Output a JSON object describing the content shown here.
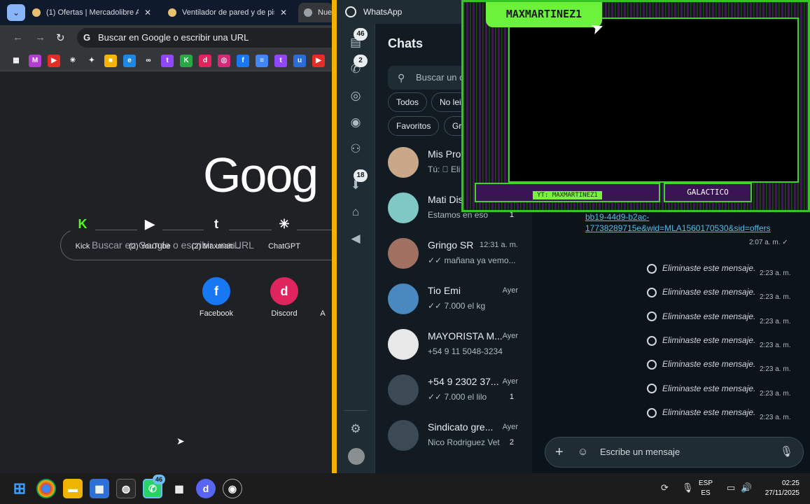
{
  "chrome": {
    "tabs": [
      {
        "title": "(1) Ofertas | Mercadolibre Ar"
      },
      {
        "title": "Ventilador de pared y de pis"
      },
      {
        "title": "Nue"
      }
    ],
    "omnibox_text": "Buscar en Google o escribir una URL",
    "bookmarks": [
      {
        "icon": "apps-icon",
        "glyph": "▦",
        "color": "#35363a"
      },
      {
        "icon": "mercado-icon",
        "glyph": "M",
        "color": "#b23dd3"
      },
      {
        "icon": "youtube-icon",
        "glyph": "▶",
        "color": "#e52d27"
      },
      {
        "icon": "chatgpt-icon",
        "glyph": "✳",
        "color": "#35363a"
      },
      {
        "icon": "gemini-icon",
        "glyph": "✦",
        "color": "#35363a"
      },
      {
        "icon": "keep-icon",
        "glyph": "■",
        "color": "#f4b400"
      },
      {
        "icon": "edge-icon",
        "glyph": "e",
        "color": "#1e88e5"
      },
      {
        "icon": "meta-icon",
        "glyph": "∞",
        "color": "#35363a"
      },
      {
        "icon": "twitch-icon",
        "glyph": "t",
        "color": "#9146ff"
      },
      {
        "icon": "kick-icon",
        "glyph": "K",
        "color": "#28a745"
      },
      {
        "icon": "discord-icon",
        "glyph": "d",
        "color": "#e0245e"
      },
      {
        "icon": "instagram-icon",
        "glyph": "◎",
        "color": "#d62976"
      },
      {
        "icon": "facebook-icon",
        "glyph": "f",
        "color": "#1877f2"
      },
      {
        "icon": "docs-icon",
        "glyph": "≡",
        "color": "#4285f4"
      },
      {
        "icon": "twitch2-icon",
        "glyph": "t",
        "color": "#9146ff"
      },
      {
        "icon": "u-icon",
        "glyph": "u",
        "color": "#2a6dd9"
      },
      {
        "icon": "youtube2-icon",
        "glyph": "▶",
        "color": "#e52d27"
      }
    ],
    "logo_text": "Goog",
    "ntp_search_placeholder": "Buscar en Google o escribir una URL",
    "shortcuts": [
      {
        "label": "Kick",
        "glyph": "K",
        "fg": "#53fc18",
        "bg": "#202124"
      },
      {
        "label": "(2) YouTube",
        "glyph": "▶",
        "fg": "#fff",
        "bg": "#202124"
      },
      {
        "label": "(2) Maxmarti...",
        "glyph": "t",
        "fg": "#fff",
        "bg": "#202124"
      },
      {
        "label": "ChatGPT",
        "glyph": "✳",
        "fg": "#fff",
        "bg": "#202124"
      },
      {
        "label": "Facebook",
        "glyph": "f",
        "fg": "#fff",
        "bg": "#1877f2"
      },
      {
        "label": "Discord",
        "glyph": "d",
        "fg": "#fff",
        "bg": "#e0245e"
      },
      {
        "label": "A",
        "glyph": "",
        "fg": "#fff",
        "bg": "#202124"
      }
    ]
  },
  "whatsapp": {
    "app_title": "WhatsApp",
    "rail": {
      "chats_badge": "46",
      "calls_badge": "2",
      "downloads_badge": "18"
    },
    "panel_title": "Chats",
    "search_placeholder": "Buscar un c",
    "filters": [
      "Todos",
      "No lei",
      "Favoritos",
      "Gr"
    ],
    "chats": [
      {
        "name": "Mis Proy",
        "time": "",
        "preview": "Tú: ⃠ Eli",
        "count": "",
        "avatar_color": "#c9a88a"
      },
      {
        "name": "Mati Dis",
        "time": "",
        "preview": "Estamos en eso",
        "count": "1",
        "avatar_color": "#7fc8c4"
      },
      {
        "name": "Gringo SR",
        "time": "12:31 a. m.",
        "preview": "✓✓ mañana ya vemo...",
        "count": "",
        "avatar_color": "#a07060"
      },
      {
        "name": "Tio Emi",
        "time": "Ayer",
        "preview": "✓✓ 7.000 el kg",
        "count": "",
        "avatar_color": "#4a88c0"
      },
      {
        "name": "MAYORISTA M...",
        "time": "Ayer",
        "preview": "+54 9 11 5048-3234",
        "count": "",
        "avatar_color": "#e8e8e8"
      },
      {
        "name": "+54 9 2302 37...",
        "time": "Ayer",
        "preview": "✓✓ 7.000 el lilo",
        "count": "1",
        "avatar_color": "#3b4a54"
      },
      {
        "name": "Sindicato gre...",
        "time": "Ayer",
        "preview": "Nico Rodriguez Vet",
        "count": "2",
        "avatar_color": "#3b4a54"
      }
    ],
    "link_text": "bb19-44d9-b2ac-17738289715e&wid=MLA1560170530&sid=offers",
    "link_time": "2:07 a. m. ✓",
    "deleted_messages": [
      {
        "text": "Eliminaste este mensaje.",
        "time": "2:23 a. m."
      },
      {
        "text": "Eliminaste este mensaje.",
        "time": "2:23 a. m."
      },
      {
        "text": "Eliminaste este mensaje.",
        "time": "2:23 a. m."
      },
      {
        "text": "Eliminaste este mensaje.",
        "time": "2:23 a. m."
      },
      {
        "text": "Eliminaste este mensaje.",
        "time": "2:23 a. m."
      },
      {
        "text": "Eliminaste este mensaje.",
        "time": "2:23 a. m."
      },
      {
        "text": "Eliminaste este mensaje.",
        "time": "2:23 a. m."
      }
    ],
    "compose_placeholder": "Escribe un mensaje"
  },
  "overlay": {
    "name": "MAXMARTINEZ1",
    "yt_tag": "YT: MAXMARTINEZ1",
    "tag": "GALACTICO"
  },
  "taskbar": {
    "whatsapp_badge": "46",
    "lang_line1": "ESP",
    "lang_line2": "ES",
    "time": "02:25",
    "date": "27/11/2025"
  }
}
